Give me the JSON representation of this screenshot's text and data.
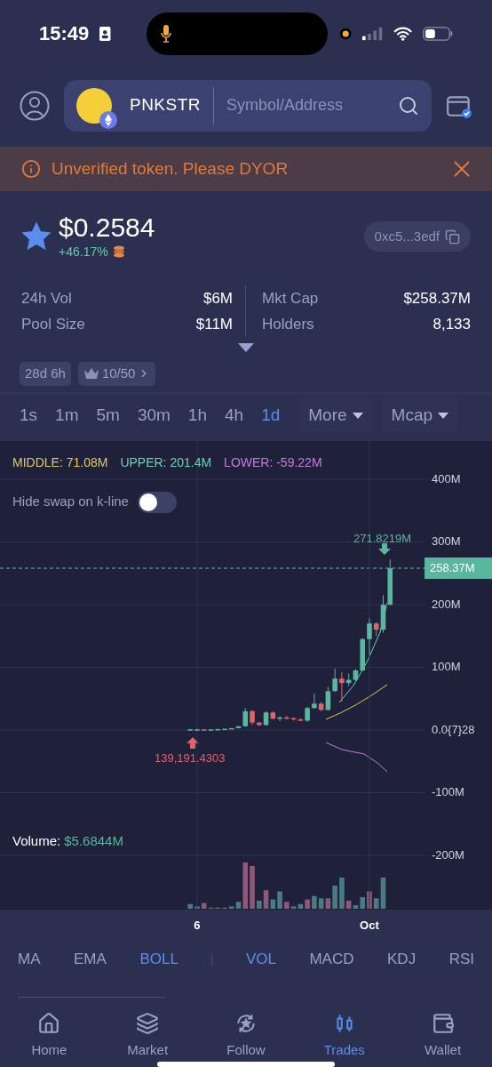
{
  "status_bar": {
    "time": "15:49"
  },
  "header": {
    "token_symbol": "PNKSTR",
    "search": {
      "placeholder": "Symbol/Address"
    }
  },
  "banner": {
    "text": "Unverified token. Please DYOR"
  },
  "price": {
    "value": "$0.2584",
    "change": "+46.17%",
    "favorited": true,
    "address": "0xc5...3edf"
  },
  "stats": [
    {
      "label": "24h Vol",
      "value": "$6M"
    },
    {
      "label": "Mkt Cap",
      "value": "$258.37M"
    },
    {
      "label": "Pool Size",
      "value": "$11M"
    },
    {
      "label": "Holders",
      "value": "8,133"
    }
  ],
  "tags": [
    {
      "kind": "age",
      "label": "28d 6h"
    },
    {
      "kind": "rank",
      "label": "10/50"
    }
  ],
  "timeframes": [
    {
      "label": "1s",
      "selected": false
    },
    {
      "label": "1m",
      "selected": false
    },
    {
      "label": "5m",
      "selected": false
    },
    {
      "label": "30m",
      "selected": false
    },
    {
      "label": "1h",
      "selected": false
    },
    {
      "label": "4h",
      "selected": false
    },
    {
      "label": "1d",
      "selected": true
    }
  ],
  "more": "More",
  "mode": "Mcap",
  "chart": {
    "legend": [
      {
        "label": "MIDDLE: 71.08M",
        "color": "#e5c65a"
      },
      {
        "label": "UPPER: 201.4M",
        "color": "#6fd1b4"
      },
      {
        "label": "LOWER: -59.22M",
        "color": "#c77ae0"
      }
    ],
    "hide_swap": {
      "label": "Hide swap on k-line",
      "on": false
    },
    "chart_data": {
      "type": "candlestick",
      "categories": [
        null,
        "6",
        null,
        null,
        null,
        null,
        null,
        null,
        null,
        null,
        null,
        null,
        null,
        null,
        null,
        null,
        null,
        null,
        null,
        null,
        null,
        null,
        null,
        null,
        null,
        null,
        "Oct",
        null,
        null,
        null
      ],
      "ohlc": [
        [
          0,
          2,
          0,
          1
        ],
        [
          1,
          2,
          0,
          1
        ],
        [
          1,
          1,
          0,
          0.5
        ],
        [
          0.5,
          1,
          0,
          1
        ],
        [
          1,
          2,
          1,
          1.5
        ],
        [
          1.5,
          2,
          1,
          2
        ],
        [
          2,
          3,
          2,
          3
        ],
        [
          3,
          6,
          3,
          6
        ],
        [
          6,
          35,
          5,
          30
        ],
        [
          30,
          32,
          8,
          12
        ],
        [
          12,
          13,
          6,
          8
        ],
        [
          8,
          30,
          7,
          28
        ],
        [
          28,
          30,
          17,
          18
        ],
        [
          18,
          22,
          14,
          20
        ],
        [
          20,
          23,
          17,
          19
        ],
        [
          19,
          20,
          15,
          17
        ],
        [
          17,
          19,
          14,
          15
        ],
        [
          15,
          37,
          13,
          35
        ],
        [
          35,
          58,
          34,
          42
        ],
        [
          42,
          45,
          30,
          32
        ],
        [
          32,
          69,
          31,
          62
        ],
        [
          62,
          98,
          61,
          82
        ],
        [
          82,
          92,
          45,
          75
        ],
        [
          75,
          90,
          70,
          80
        ],
        [
          80,
          97,
          78,
          95
        ],
        [
          95,
          147,
          94,
          145
        ],
        [
          145,
          178,
          120,
          170
        ],
        [
          170,
          172,
          150,
          160
        ],
        [
          160,
          215,
          155,
          200
        ],
        [
          200,
          272,
          198,
          258
        ]
      ],
      "grid": true,
      "ylim": [
        -286.5,
        461
      ],
      "yticks": [
        {
          "value": 400,
          "label": "400M"
        },
        {
          "value": 300,
          "label": "300M"
        },
        {
          "value": 200,
          "label": "200M"
        },
        {
          "value": 100,
          "label": "100M"
        },
        {
          "value": 0,
          "label": "0.0{7}28"
        },
        {
          "value": -100,
          "label": "-100M"
        },
        {
          "value": -200,
          "label": "-200M"
        }
      ]
    },
    "high_label": "271.8219M",
    "low_label": "139,191.4303",
    "current_price": "258.37M",
    "volume_label": "Volume:",
    "volume_value": "$5.6844M"
  },
  "indicators": [
    {
      "label": "MA",
      "selected": false
    },
    {
      "label": "EMA",
      "selected": false
    },
    {
      "label": "BOLL",
      "selected": true
    },
    {
      "label": "VOL",
      "selected": true
    },
    {
      "label": "MACD",
      "selected": false
    },
    {
      "label": "KDJ",
      "selected": false
    },
    {
      "label": "RSI",
      "selected": false
    }
  ],
  "nav": [
    {
      "label": "Home",
      "selected": false
    },
    {
      "label": "Market",
      "selected": false
    },
    {
      "label": "Follow",
      "selected": false
    },
    {
      "label": "Trades",
      "selected": true
    },
    {
      "label": "Wallet",
      "selected": false
    }
  ]
}
